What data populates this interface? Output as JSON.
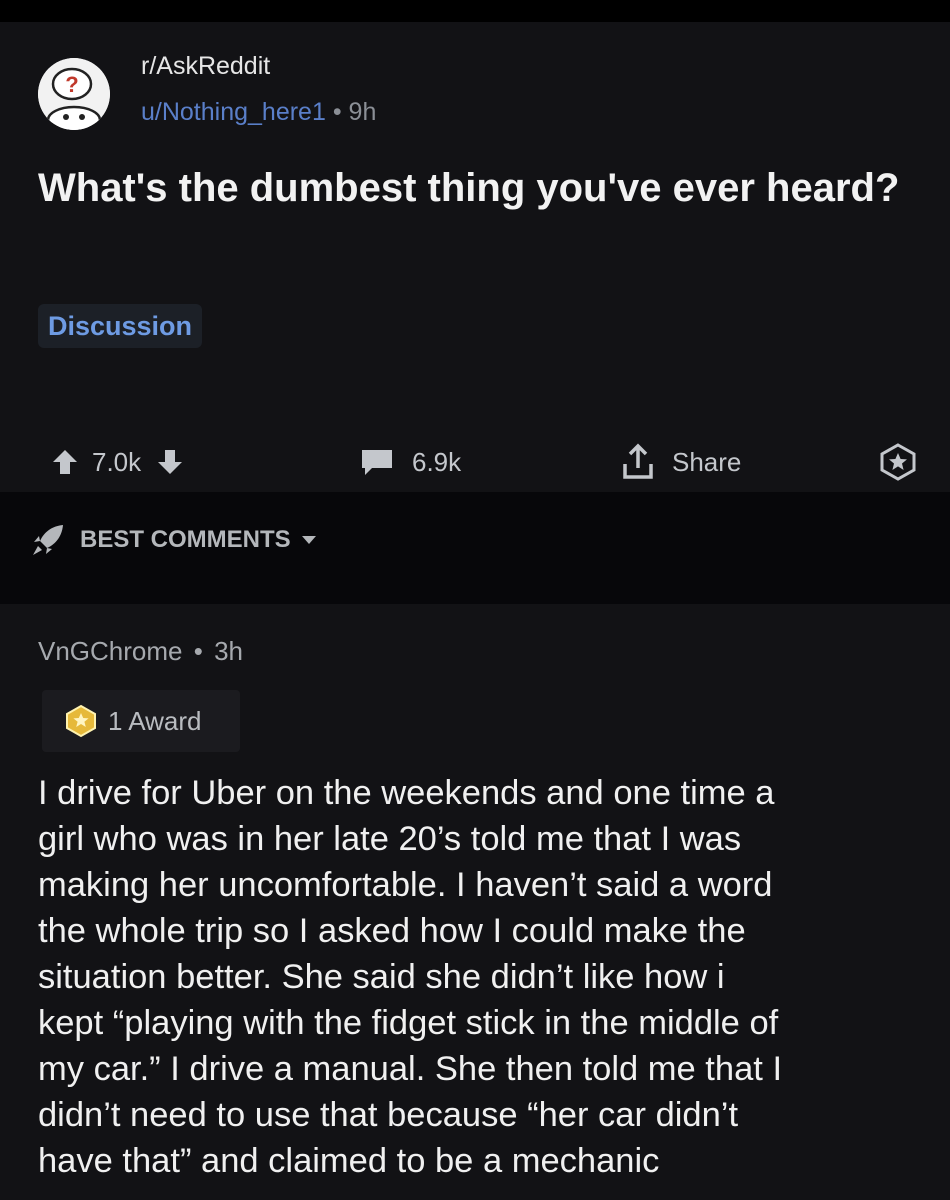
{
  "post": {
    "subreddit": "r/AskReddit",
    "author": "u/Nothing_here1",
    "separator": "•",
    "age": "9h",
    "title": "What's the dumbest thing you've ever heard?",
    "flair": "Discussion",
    "upvotes": "7.0k",
    "comments": "6.9k",
    "share_label": "Share"
  },
  "sort": {
    "label": "BEST COMMENTS"
  },
  "comment": {
    "author": "VnGChrome",
    "separator": "•",
    "age": "3h",
    "award_label": "1 Award",
    "lines": [
      "I drive for Uber on the weekends and one time a",
      "girl who was in her late 20’s told me that I was",
      "making her uncomfortable. I haven’t said a word",
      "the whole trip so I asked how I could make the",
      "situation better. She said she didn’t like how i",
      "kept “playing with the fidget stick in the middle of",
      "my car.” I drive a manual. She then told me that I",
      "didn’t need to use that because “her car didn’t",
      "have that” and claimed to be a mechanic"
    ]
  },
  "colors": {
    "background": "#121215",
    "link_blue": "#5a7fc9",
    "flair_blue": "#6e9be3"
  }
}
